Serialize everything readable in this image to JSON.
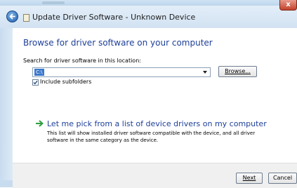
{
  "window": {
    "title": "Update Driver Software - Unknown Device",
    "close_glyph": "x"
  },
  "page": {
    "heading": "Browse for driver software on your computer",
    "location_label": "Search for driver software in this location:",
    "location_value": "C:\\",
    "browse_label": "Browse...",
    "include_subfolders_label": "Include subfolders",
    "include_subfolders_checked": true,
    "pick_link": "Let me pick from a list of device drivers on my computer",
    "pick_description": "This list will show installed driver software compatible with the device, and all driver software in the same category as the device."
  },
  "footer": {
    "next_label": "Next",
    "cancel_label": "Cancel"
  },
  "colors": {
    "heading": "#1e3f99",
    "selection": "#3a78cc",
    "arrow": "#2f9e3e"
  },
  "icons": [
    "back-arrow-icon",
    "device-icon",
    "dropdown-arrow-icon",
    "checkmark-icon",
    "green-arrow-icon"
  ]
}
